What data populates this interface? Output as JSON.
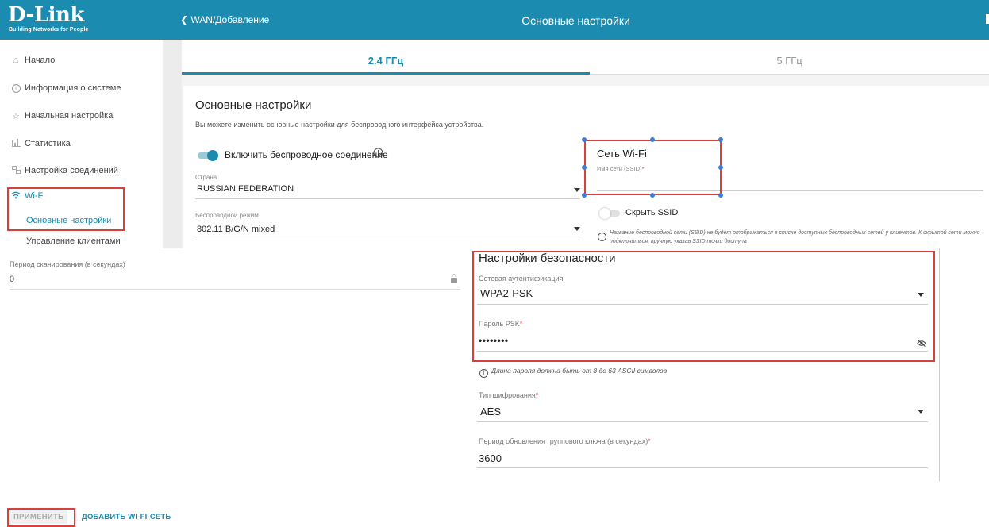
{
  "brand": {
    "logo": "D-Link",
    "tagline": "Building Networks for People",
    "accent": "#1b8bb0",
    "highlight": "#d9403a"
  },
  "header": {
    "back_label": "WAN/Добавление",
    "title": "Основные настройки"
  },
  "tabs": [
    {
      "label": "2.4 ГГц",
      "active": true
    },
    {
      "label": "5 ГГц",
      "active": false
    }
  ],
  "sidebar": {
    "items": [
      {
        "label": "Начало",
        "icon": "home-icon"
      },
      {
        "label": "Информация о системе",
        "icon": "info-icon"
      },
      {
        "label": "Начальная настройка",
        "icon": "star-icon"
      },
      {
        "label": "Статистика",
        "icon": "chart-icon"
      },
      {
        "label": "Настройка соединений",
        "icon": "connections-icon"
      },
      {
        "label": "Wi-Fi",
        "icon": "wifi-icon"
      }
    ],
    "wifi_subitems": [
      {
        "label": "Основные настройки",
        "active": true
      },
      {
        "label": "Управление клиентами",
        "active": false
      }
    ]
  },
  "basic": {
    "heading": "Основные настройки",
    "description": "Вы можете изменить основные настройки для беспроводного интерфейса устройства.",
    "enable_wireless_label": "Включить беспроводное соединение",
    "country_label": "Страна",
    "country_value": "RUSSIAN FEDERATION",
    "mode_label": "Беспроводной режим",
    "mode_value": "802.11 B/G/N mixed"
  },
  "wifi_network": {
    "heading": "Сеть Wi-Fi",
    "ssid_label": "Имя сети (SSID)",
    "ssid_value": "",
    "hide_ssid_label": "Скрыть SSID",
    "hide_ssid_note": "Название беспроводной сети (SSID) не будет отображаться в списке доступных беспроводных сетей у клиентов. К скрытой сети можно подключиться, вручную указав SSID точки доступа"
  },
  "scan": {
    "label": "Период сканирования (в секундах)",
    "value": "0"
  },
  "security": {
    "heading": "Настройки безопасности",
    "auth_label": "Сетевая аутентификация",
    "auth_value": "WPA2-PSK",
    "psk_label": "Пароль PSK",
    "psk_value": "••••••••",
    "psk_hint": "Длина пароля должна быть от 8 до 63 ASCII символов",
    "cipher_label": "Тип шифрования",
    "cipher_value": "AES",
    "group_key_label": "Период обновления группового ключа (в секундах)",
    "group_key_value": "3600"
  },
  "actions": {
    "apply": "ПРИМЕНИТЬ",
    "add_wifi": "ДОБАВИТЬ WI-FI-СЕТЬ"
  }
}
